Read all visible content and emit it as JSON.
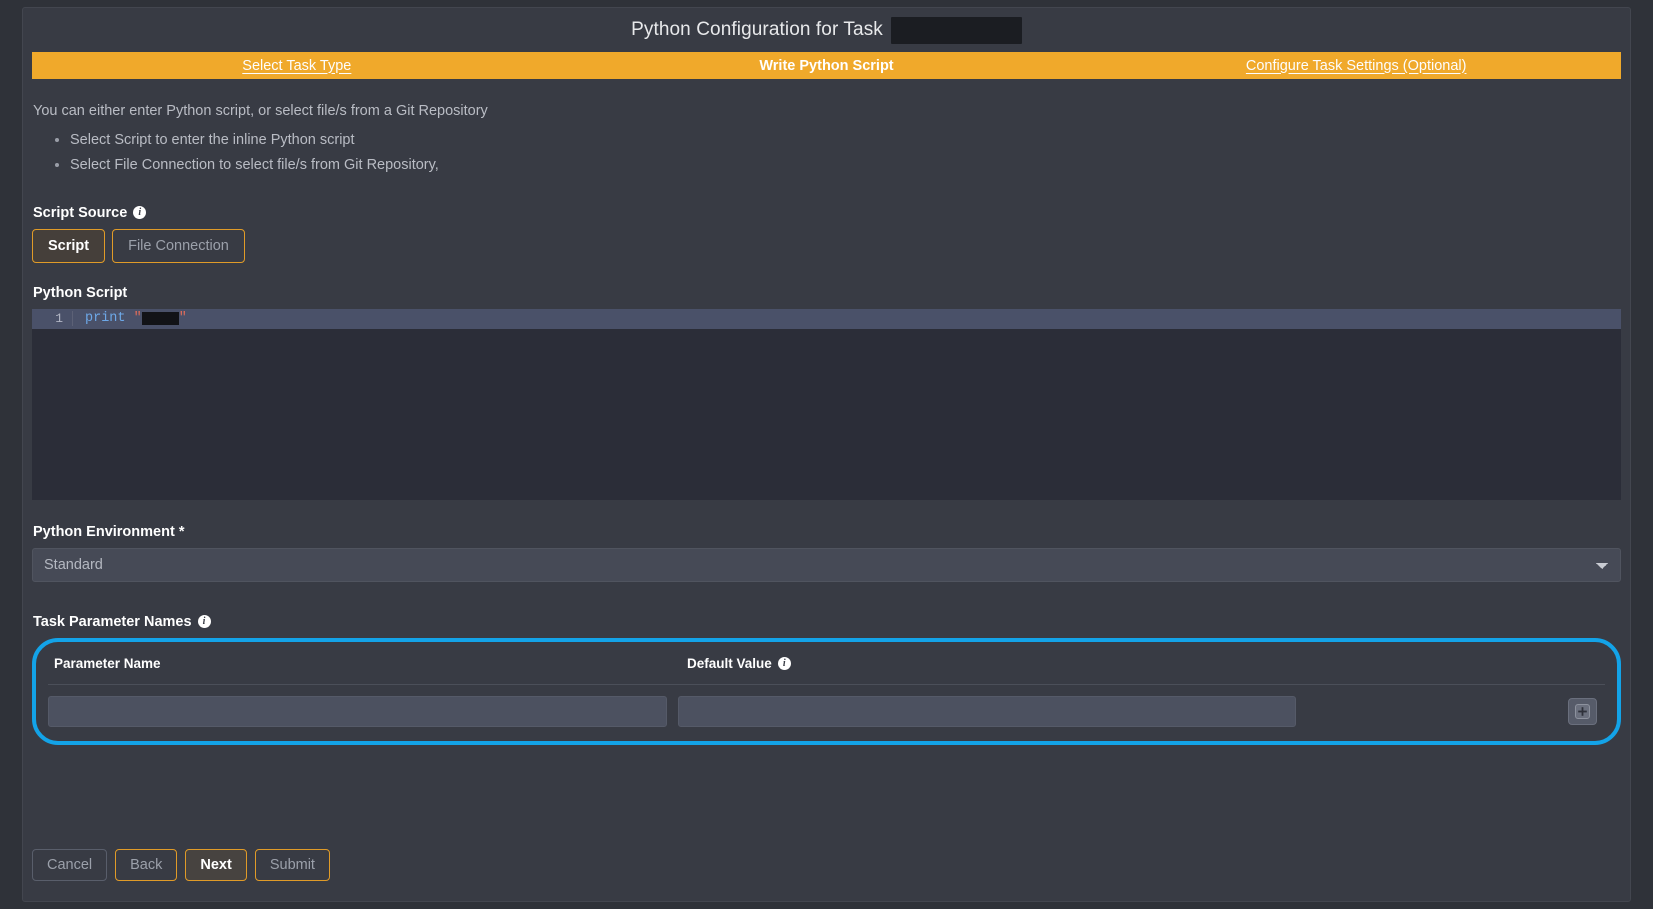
{
  "window": {
    "title": "Python Configuration for Task",
    "title_redacted": true
  },
  "colors": {
    "accent_amber": "#f0a92b",
    "highlight_blue": "#13a3e8",
    "page_bg": "#383b44",
    "editor_bg": "#2b2d38"
  },
  "tabs": [
    {
      "label": "Select Task Type",
      "active": false
    },
    {
      "label": "Write Python Script",
      "active": true
    },
    {
      "label": "Configure Task Settings (Optional)",
      "active": false
    }
  ],
  "intro": {
    "text": "You can either enter Python script, or select file/s from a Git Repository",
    "bullets": [
      "Select Script to enter the inline Python script",
      "Select File Connection to select file/s from Git Repository,"
    ]
  },
  "script_source": {
    "label": "Script Source",
    "info_icon": "info-icon",
    "options": [
      {
        "label": "Script",
        "selected": true
      },
      {
        "label": "File Connection",
        "selected": false
      }
    ]
  },
  "python_script": {
    "label": "Python Script",
    "line_number": "1",
    "code_keyword": "print",
    "quote_open": "\"",
    "quote_close": "\"",
    "code_redacted": true
  },
  "python_environment": {
    "label": "Python Environment *",
    "value": "Standard",
    "options": [
      "Standard"
    ]
  },
  "task_parameters": {
    "label": "Task Parameter Names",
    "info_icon": "info-icon",
    "columns": [
      {
        "label": "Parameter Name",
        "has_info": false
      },
      {
        "label": "Default Value",
        "has_info": true
      }
    ],
    "rows": [
      {
        "name": "",
        "name_placeholder": "",
        "default_value": "",
        "value_placeholder": ""
      }
    ],
    "add_button_icon": "plus-icon"
  },
  "footer": {
    "buttons": [
      {
        "label": "Cancel",
        "style": "plain"
      },
      {
        "label": "Back",
        "style": "amber"
      },
      {
        "label": "Next",
        "style": "primary"
      },
      {
        "label": "Submit",
        "style": "amber"
      }
    ]
  }
}
